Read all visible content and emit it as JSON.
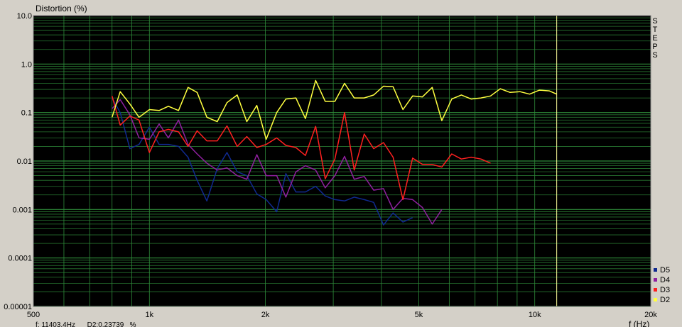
{
  "chart_data": {
    "type": "line",
    "title": "",
    "ylabel": "Distortion (%)",
    "xlabel": "f (Hz)",
    "xscale": "log",
    "yscale": "log",
    "xlim": [
      500,
      20000
    ],
    "ylim": [
      1e-05,
      10
    ],
    "x_tick_labels": [
      {
        "value": 500,
        "label": "500"
      },
      {
        "value": 1000,
        "label": "1k"
      },
      {
        "value": 2000,
        "label": "2k"
      },
      {
        "value": 5000,
        "label": "5k"
      },
      {
        "value": 10000,
        "label": "10k"
      },
      {
        "value": 20000,
        "label": "20k"
      }
    ],
    "y_tick_labels": [
      {
        "value": 10,
        "label": "10.0"
      },
      {
        "value": 1,
        "label": "1.0"
      },
      {
        "value": 0.1,
        "label": "0.1"
      },
      {
        "value": 0.01,
        "label": "0.01"
      },
      {
        "value": 0.001,
        "label": "0.001"
      },
      {
        "value": 0.0001,
        "label": "0.0001"
      },
      {
        "value": 1e-05,
        "label": "0.00001"
      }
    ],
    "grid": true,
    "legend_position": "bottom-right",
    "cursor_x": 11403.4,
    "background_color": "#000000",
    "grid_color": "#2e8b3a",
    "cursor_color": "#ffff99",
    "series": [
      {
        "name": "D2",
        "color": "#ffff40",
        "points": [
          [
            800,
            0.08
          ],
          [
            840,
            0.27
          ],
          [
            890,
            0.15
          ],
          [
            940,
            0.08
          ],
          [
            1000,
            0.115
          ],
          [
            1060,
            0.11
          ],
          [
            1120,
            0.135
          ],
          [
            1190,
            0.11
          ],
          [
            1260,
            0.33
          ],
          [
            1330,
            0.26
          ],
          [
            1410,
            0.08
          ],
          [
            1500,
            0.065
          ],
          [
            1590,
            0.16
          ],
          [
            1690,
            0.23
          ],
          [
            1790,
            0.065
          ],
          [
            1900,
            0.14
          ],
          [
            2010,
            0.028
          ],
          [
            2140,
            0.1
          ],
          [
            2260,
            0.19
          ],
          [
            2400,
            0.2
          ],
          [
            2540,
            0.075
          ],
          [
            2700,
            0.46
          ],
          [
            2860,
            0.17
          ],
          [
            3030,
            0.17
          ],
          [
            3210,
            0.4
          ],
          [
            3400,
            0.2
          ],
          [
            3610,
            0.2
          ],
          [
            3820,
            0.23
          ],
          [
            4050,
            0.35
          ],
          [
            4290,
            0.34
          ],
          [
            4550,
            0.115
          ],
          [
            4820,
            0.22
          ],
          [
            5110,
            0.21
          ],
          [
            5420,
            0.33
          ],
          [
            5740,
            0.068
          ],
          [
            6090,
            0.19
          ],
          [
            6450,
            0.23
          ],
          [
            6840,
            0.19
          ],
          [
            7250,
            0.2
          ],
          [
            7680,
            0.22
          ],
          [
            8140,
            0.31
          ],
          [
            8630,
            0.26
          ],
          [
            9150,
            0.27
          ],
          [
            9700,
            0.24
          ],
          [
            10280,
            0.29
          ],
          [
            10900,
            0.28
          ],
          [
            11400,
            0.24
          ]
        ]
      },
      {
        "name": "D3",
        "color": "#ff2020",
        "points": [
          [
            800,
            0.22
          ],
          [
            840,
            0.055
          ],
          [
            890,
            0.085
          ],
          [
            940,
            0.07
          ],
          [
            1000,
            0.015
          ],
          [
            1060,
            0.04
          ],
          [
            1120,
            0.045
          ],
          [
            1190,
            0.04
          ],
          [
            1260,
            0.02
          ],
          [
            1330,
            0.042
          ],
          [
            1410,
            0.026
          ],
          [
            1500,
            0.026
          ],
          [
            1590,
            0.053
          ],
          [
            1690,
            0.02
          ],
          [
            1790,
            0.032
          ],
          [
            1900,
            0.019
          ],
          [
            2010,
            0.022
          ],
          [
            2140,
            0.03
          ],
          [
            2260,
            0.021
          ],
          [
            2400,
            0.019
          ],
          [
            2540,
            0.013
          ],
          [
            2700,
            0.052
          ],
          [
            2860,
            0.0043
          ],
          [
            3030,
            0.011
          ],
          [
            3210,
            0.1
          ],
          [
            3400,
            0.0065
          ],
          [
            3610,
            0.036
          ],
          [
            3820,
            0.018
          ],
          [
            4050,
            0.024
          ],
          [
            4290,
            0.012
          ],
          [
            4550,
            0.0016
          ],
          [
            4820,
            0.0115
          ],
          [
            5110,
            0.0085
          ],
          [
            5420,
            0.0085
          ],
          [
            5740,
            0.0075
          ],
          [
            6090,
            0.014
          ],
          [
            6450,
            0.011
          ],
          [
            6840,
            0.012
          ],
          [
            7250,
            0.011
          ],
          [
            7680,
            0.009
          ]
        ]
      },
      {
        "name": "D4",
        "color": "#9020a0",
        "points": [
          [
            800,
            0.12
          ],
          [
            840,
            0.185
          ],
          [
            890,
            0.09
          ],
          [
            940,
            0.03
          ],
          [
            1000,
            0.028
          ],
          [
            1060,
            0.058
          ],
          [
            1120,
            0.03
          ],
          [
            1190,
            0.07
          ],
          [
            1260,
            0.022
          ],
          [
            1330,
            0.014
          ],
          [
            1410,
            0.009
          ],
          [
            1500,
            0.0065
          ],
          [
            1590,
            0.0072
          ],
          [
            1690,
            0.005
          ],
          [
            1790,
            0.0042
          ],
          [
            1900,
            0.0135
          ],
          [
            2010,
            0.005
          ],
          [
            2140,
            0.005
          ],
          [
            2260,
            0.0018
          ],
          [
            2400,
            0.006
          ],
          [
            2540,
            0.008
          ],
          [
            2700,
            0.0065
          ],
          [
            2860,
            0.0028
          ],
          [
            3030,
            0.005
          ],
          [
            3210,
            0.0125
          ],
          [
            3400,
            0.0042
          ],
          [
            3610,
            0.0048
          ],
          [
            3820,
            0.0025
          ],
          [
            4050,
            0.0027
          ],
          [
            4290,
            0.001
          ],
          [
            4550,
            0.0017
          ],
          [
            4820,
            0.0016
          ],
          [
            5110,
            0.0011
          ],
          [
            5420,
            0.0005
          ],
          [
            5740,
            0.001
          ]
        ]
      },
      {
        "name": "D5",
        "color": "#102a90",
        "points": [
          [
            800,
            0.2
          ],
          [
            840,
            0.1
          ],
          [
            890,
            0.018
          ],
          [
            940,
            0.022
          ],
          [
            1000,
            0.05
          ],
          [
            1060,
            0.022
          ],
          [
            1120,
            0.022
          ],
          [
            1190,
            0.02
          ],
          [
            1260,
            0.012
          ],
          [
            1330,
            0.004
          ],
          [
            1410,
            0.0015
          ],
          [
            1500,
            0.007
          ],
          [
            1590,
            0.015
          ],
          [
            1690,
            0.006
          ],
          [
            1790,
            0.005
          ],
          [
            1900,
            0.0021
          ],
          [
            2010,
            0.0016
          ],
          [
            2140,
            0.0009
          ],
          [
            2260,
            0.0055
          ],
          [
            2400,
            0.0023
          ],
          [
            2540,
            0.0023
          ],
          [
            2700,
            0.003
          ],
          [
            2860,
            0.0019
          ],
          [
            3030,
            0.0016
          ],
          [
            3210,
            0.0015
          ],
          [
            3400,
            0.0018
          ],
          [
            3610,
            0.0016
          ],
          [
            3820,
            0.0014
          ],
          [
            4050,
            0.00048
          ],
          [
            4290,
            0.00085
          ],
          [
            4550,
            0.00055
          ],
          [
            4820,
            0.00068
          ]
        ]
      }
    ],
    "legend": [
      "D5",
      "D4",
      "D3",
      "D2"
    ]
  },
  "side_label": [
    "S",
    "T",
    "E",
    "P",
    "S"
  ],
  "status": {
    "cursor_readout": "f: 11403.4Hz      D2:0.23739   %"
  }
}
